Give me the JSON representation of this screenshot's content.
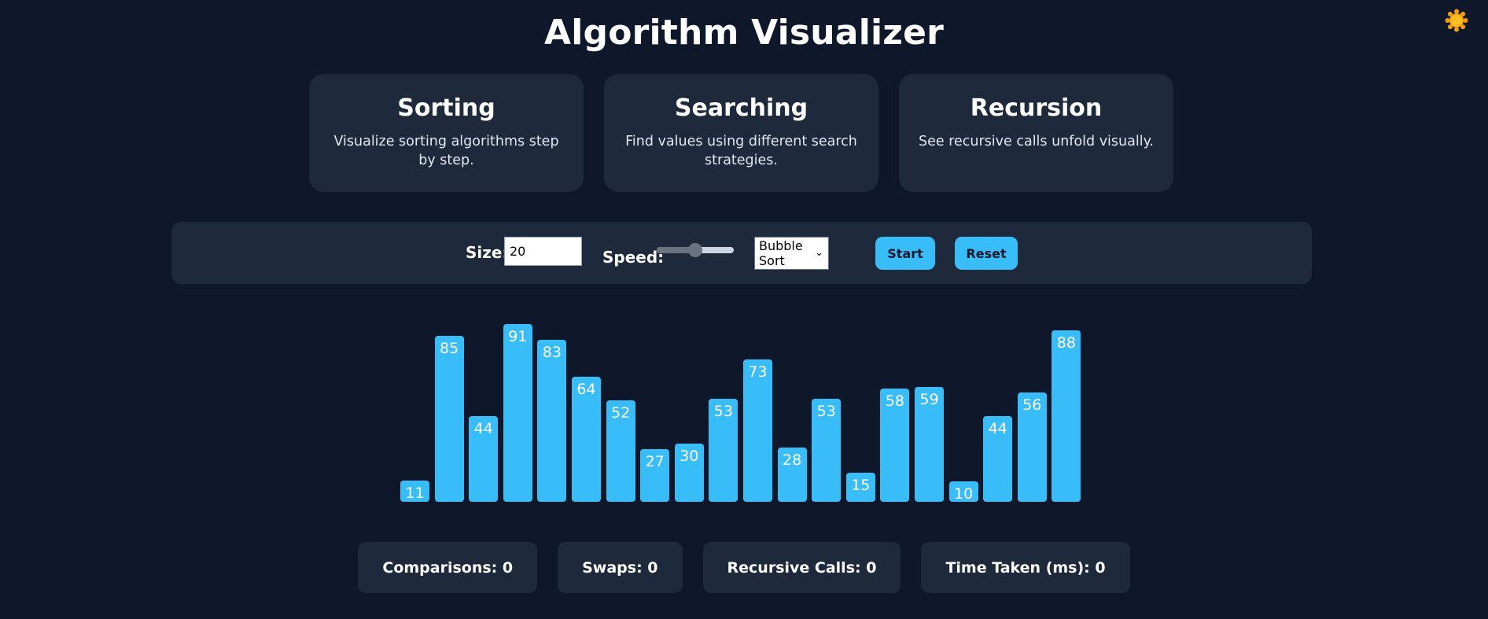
{
  "app": {
    "title": "Algorithm Visualizer",
    "theme_icon": "sun-icon"
  },
  "cards": [
    {
      "title": "Sorting",
      "description": "Visualize sorting algorithms step by step."
    },
    {
      "title": "Searching",
      "description": "Find values using different search strategies."
    },
    {
      "title": "Recursion",
      "description": "See recursive calls unfold visually."
    }
  ],
  "controls": {
    "size_label": "Size:",
    "size_value": "20",
    "speed_label": "Speed:",
    "speed_level": 0.5,
    "algorithm_selected": "Bubble Sort",
    "start_label": "Start",
    "reset_label": "Reset"
  },
  "colors": {
    "background": "#0f172a",
    "panel": "#1e293b",
    "accent": "#38bdf8",
    "sun": "#f59e0b"
  },
  "array_values": [
    11,
    85,
    44,
    91,
    83,
    64,
    52,
    27,
    30,
    53,
    73,
    28,
    53,
    15,
    58,
    59,
    10,
    44,
    56,
    88
  ],
  "stats": {
    "comparisons": "Comparisons: 0",
    "swaps": "Swaps: 0",
    "recursive_calls": "Recursive Calls: 0",
    "time_taken": "Time Taken (ms): 0"
  }
}
